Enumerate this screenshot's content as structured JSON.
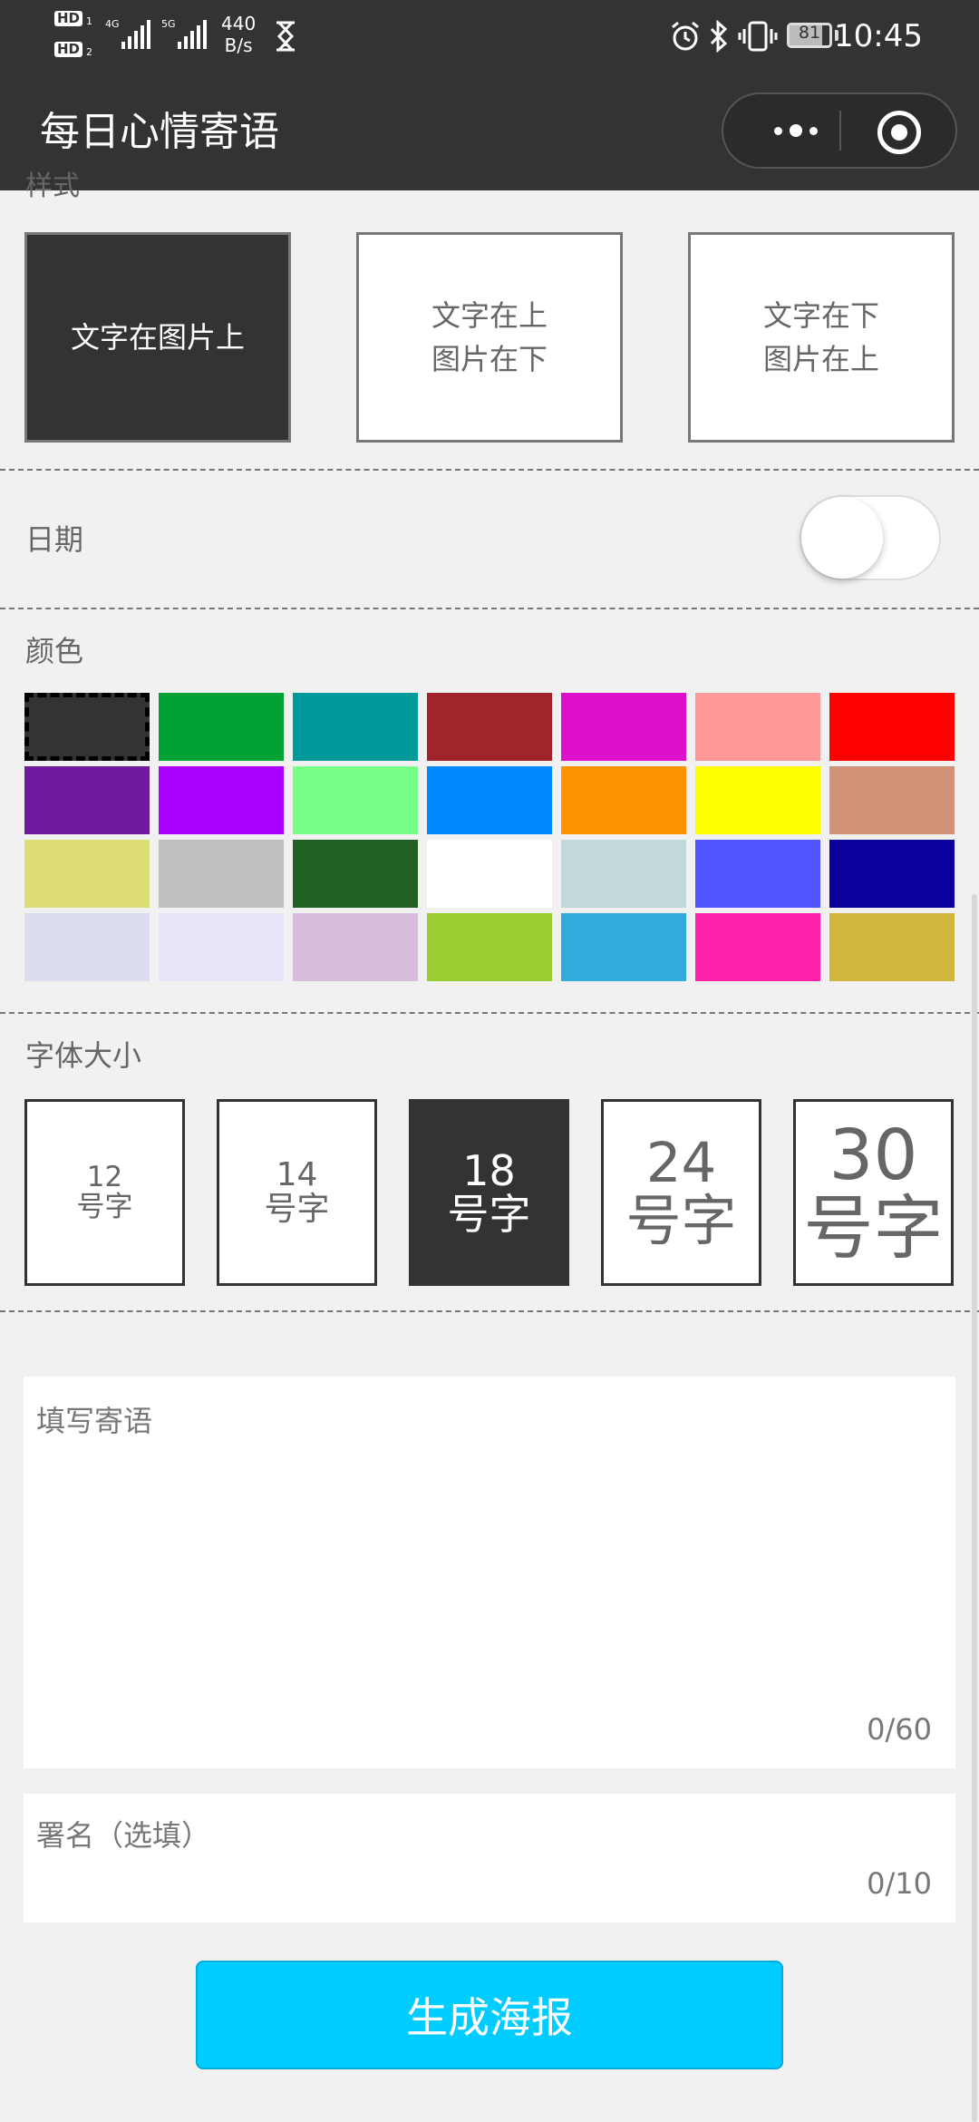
{
  "status_bar": {
    "hd1": "HD",
    "hd1_sub": "1",
    "hd2": "HD",
    "hd2_sub": "2",
    "net1": "4G",
    "net2": "5G",
    "speed_value": "440",
    "speed_unit": "B/s",
    "battery": "81",
    "time": "10:45",
    "icons": [
      "hourglass-icon",
      "alarm-icon",
      "bluetooth-icon",
      "vibrate-icon",
      "battery-icon"
    ]
  },
  "nav": {
    "title": "每日心情寄语",
    "icons": [
      "more-icon",
      "close-icon"
    ]
  },
  "style_section": {
    "title": "样式",
    "options": [
      {
        "label": "文字在图片上",
        "active": true
      },
      {
        "label": "文字在上\n图片在下",
        "active": false
      },
      {
        "label": "文字在下\n图片在上",
        "active": false
      }
    ]
  },
  "date_section": {
    "label": "日期",
    "enabled": false
  },
  "color_section": {
    "title": "颜色",
    "selected_index": 0,
    "colors": [
      "#333333",
      "#00a135",
      "#00999a",
      "#a0242c",
      "#dd11cc",
      "#ff9999",
      "#ff0000",
      "#701b9e",
      "#aa00ff",
      "#77ff88",
      "#0088ff",
      "#ff9400",
      "#ffff00",
      "#d09377",
      "#dddd77",
      "#c0c0c0",
      "#225f23",
      "#ffffff",
      "#c1d9da",
      "#5155ff",
      "#0c009c",
      "#dcdcf0",
      "#e6e6f8",
      "#d8bedc",
      "#9acd32",
      "#33aadd",
      "#ff22aa",
      "#d1b63d"
    ]
  },
  "font_section": {
    "title": "字体大小",
    "selected_index": 2,
    "options": [
      {
        "num": "12",
        "unit": "号字",
        "size": 12
      },
      {
        "num": "14",
        "unit": "号字",
        "size": 14
      },
      {
        "num": "18",
        "unit": "号字",
        "size": 18
      },
      {
        "num": "24",
        "unit": "号字",
        "size": 24
      },
      {
        "num": "30",
        "unit": "号字",
        "size": 30
      }
    ]
  },
  "message": {
    "placeholder": "填写寄语",
    "value": "",
    "count": "0/60"
  },
  "signature": {
    "placeholder": "署名（选填）",
    "value": "",
    "count": "0/10"
  },
  "generate_button": {
    "label": "生成海报",
    "color": "#00ccff"
  }
}
